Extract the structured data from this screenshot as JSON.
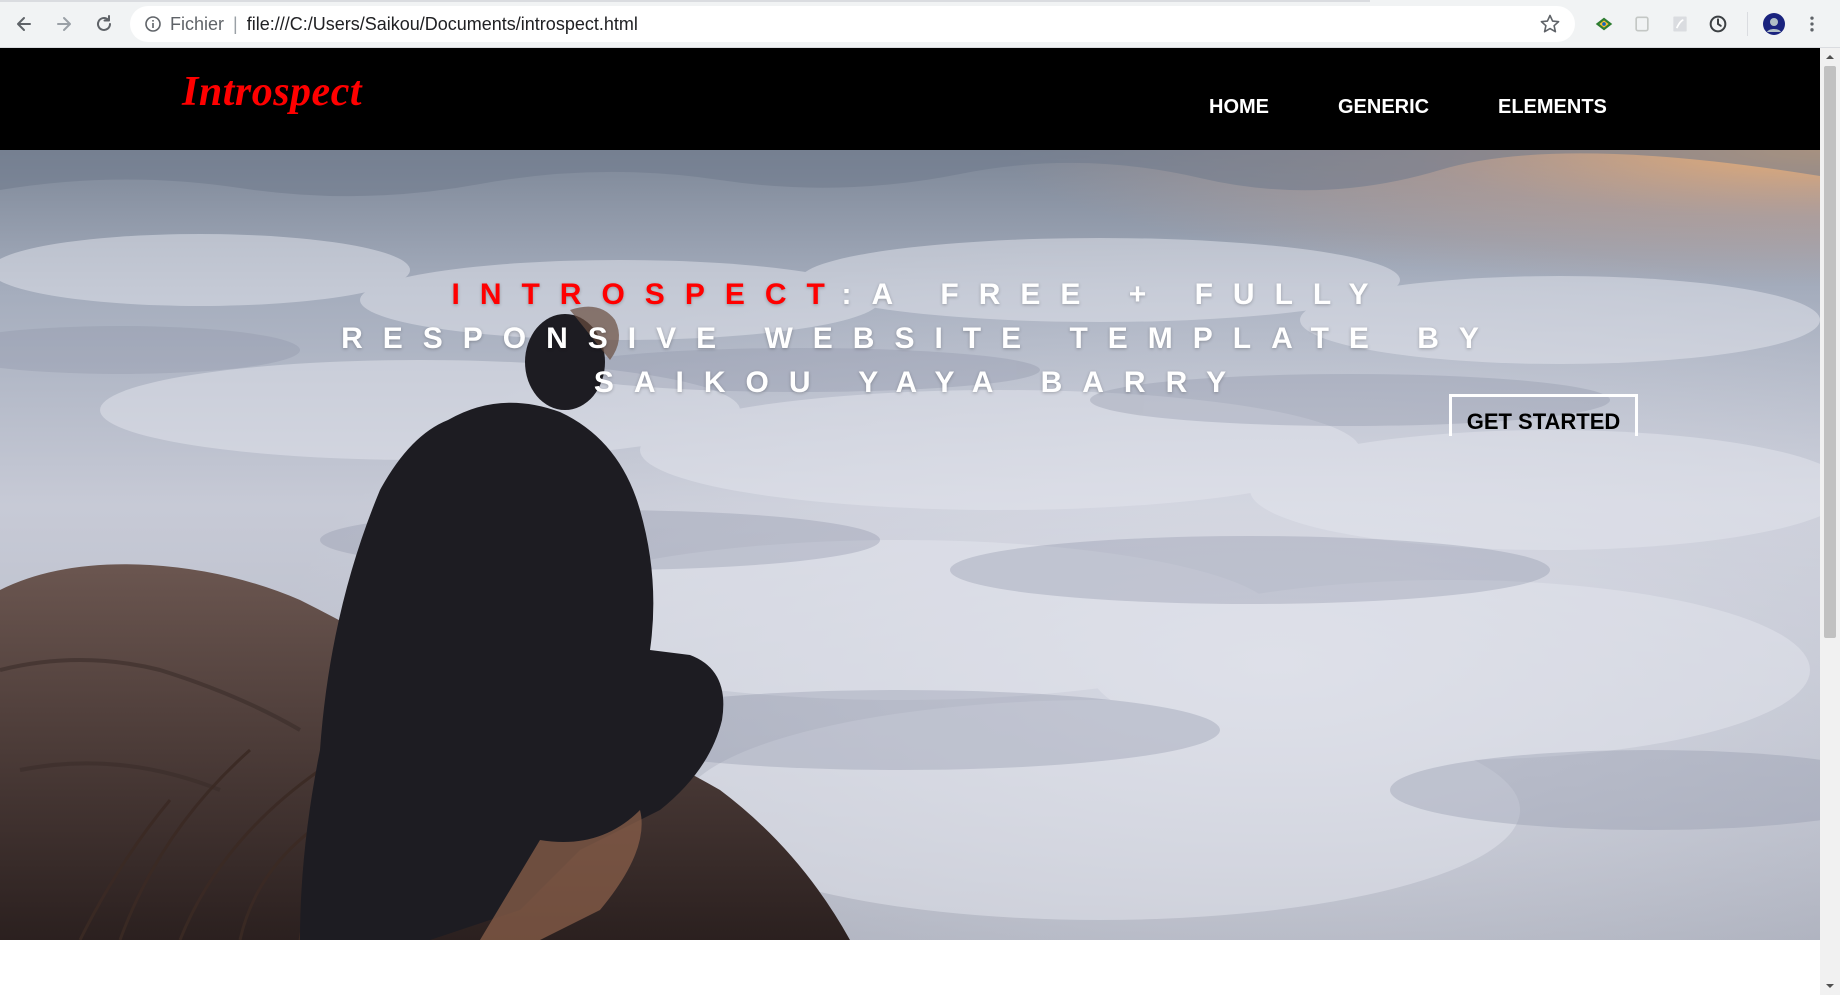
{
  "browser": {
    "url_scheme_label": "Fichier",
    "url": "file:///C:/Users/Saikou/Documents/introspect.html",
    "icons": [
      "back-arrow-icon",
      "forward-arrow-icon",
      "reload-icon",
      "info-icon",
      "star-icon",
      "extension-icon",
      "menu-icon"
    ]
  },
  "site": {
    "logo": "Introspect",
    "nav": [
      "HOME",
      "GENERIC",
      "ELEMENTS"
    ]
  },
  "hero": {
    "brand": "INTROSPECT",
    "title_rest": ":A FREE + FULLY RESPONSIVE WEBSITE TEMPLATE BY SAIKOU YAYA BARRY",
    "cta_label": "GET STARTED"
  },
  "colors": {
    "header_bg": "#000000",
    "accent": "#ff0000",
    "nav_text": "#ffffff"
  }
}
